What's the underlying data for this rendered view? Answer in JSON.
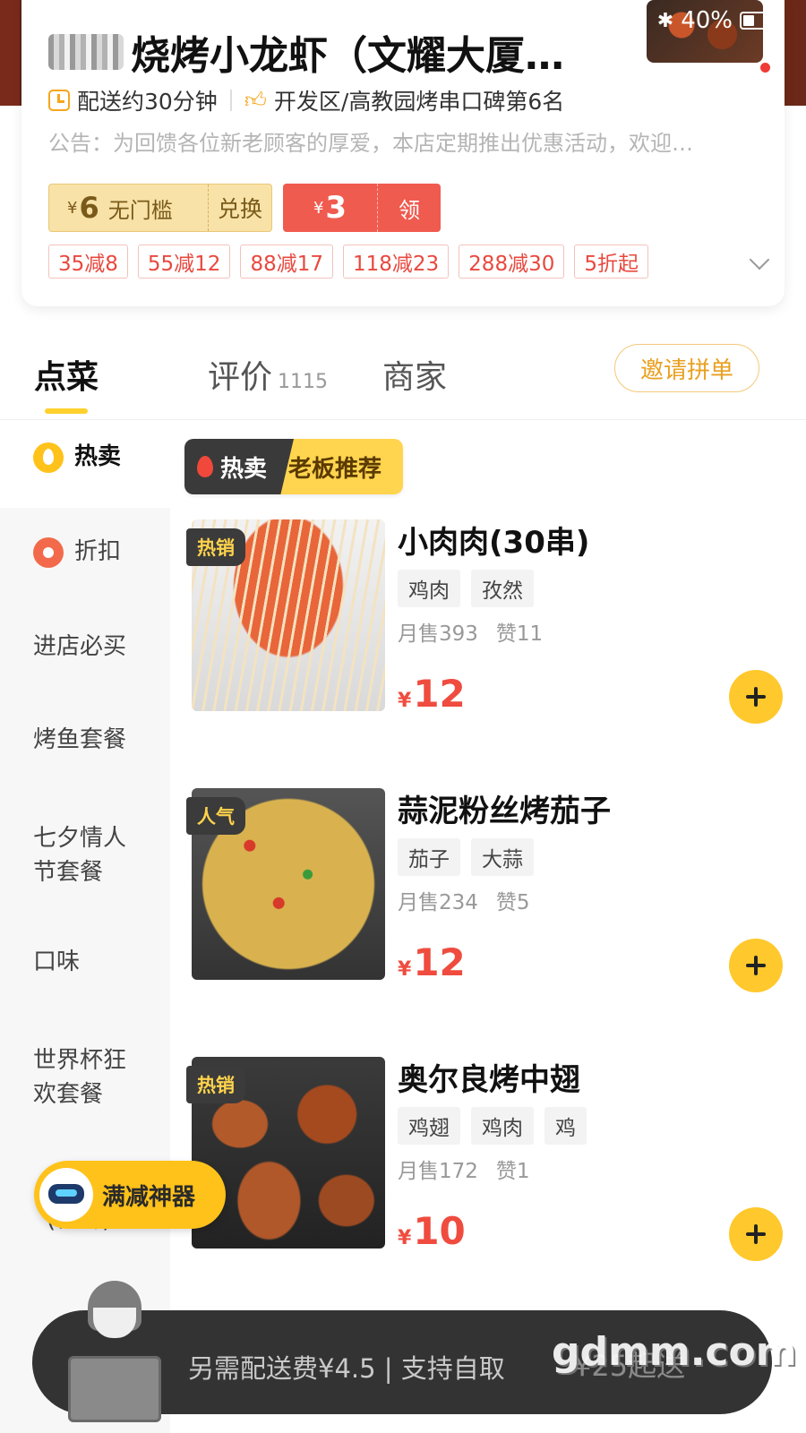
{
  "status_bar": {
    "battery": "40%"
  },
  "store": {
    "title": "烧烤小龙虾（文耀大厦…",
    "delivery_time": "配送约30分钟",
    "ranking": "开发区/高教园烤串口碑第6名",
    "notice": "公告：为回馈各位新老顾客的厚爱，本店定期推出优惠活动，欢迎…"
  },
  "coupons": [
    {
      "currency": "¥",
      "amount": "6",
      "label": "无门槛",
      "action": "兑换"
    },
    {
      "currency": "¥",
      "amount": "3",
      "action": "领"
    }
  ],
  "promotions": [
    "35减8",
    "55减12",
    "88减17",
    "118减23",
    "288减30",
    "5折起"
  ],
  "tabs": [
    {
      "label": "点菜",
      "active": true
    },
    {
      "label": "评价",
      "count": "1115"
    },
    {
      "label": "商家"
    }
  ],
  "invite_button": "邀请拼单",
  "sidebar": [
    {
      "label": "热卖",
      "icon": "fire-icon",
      "active": true
    },
    {
      "label": "折扣",
      "icon": "discount-tag-icon"
    },
    {
      "label": "进店必买"
    },
    {
      "label": "烤鱼套餐"
    },
    {
      "label": "七夕情人节套餐"
    },
    {
      "label": "口味"
    },
    {
      "label": "世界杯狂欢套餐"
    },
    {
      "label": "(新鲜)"
    }
  ],
  "section": {
    "tag": "热卖",
    "title": "老板推荐"
  },
  "dishes": [
    {
      "name": "小肉肉(30串)",
      "badge": "热销",
      "tags": [
        "鸡肉",
        "孜然"
      ],
      "sales": "月售393",
      "likes": "赞11",
      "currency": "¥",
      "price": "12"
    },
    {
      "name": "蒜泥粉丝烤茄子",
      "badge": "人气",
      "tags": [
        "茄子",
        "大蒜"
      ],
      "sales": "月售234",
      "likes": "赞5",
      "currency": "¥",
      "price": "12"
    },
    {
      "name": "奥尔良烤中翅",
      "badge": "热销",
      "tags": [
        "鸡翅",
        "鸡肉",
        "鸡"
      ],
      "sales": "月售172",
      "likes": "赞1",
      "currency": "¥",
      "price": "10"
    }
  ],
  "floating_promo": "满减神器",
  "cart": {
    "delivery_info": "另需配送费¥4.5 | 支持自取",
    "min_order": "¥25起送"
  },
  "watermark": "gdmm.com",
  "colors": {
    "accent_yellow": "#ffc82c",
    "price_red": "#ef4c3f",
    "cart_bar": "#333333"
  }
}
